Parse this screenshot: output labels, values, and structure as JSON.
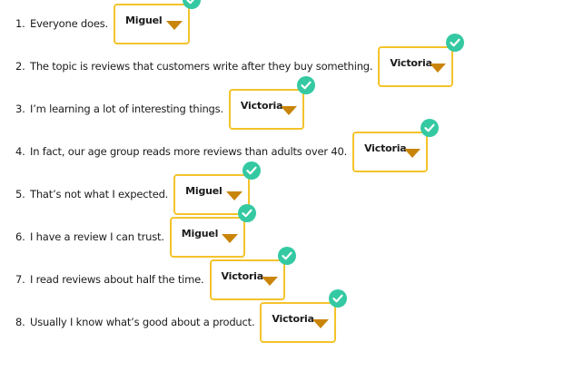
{
  "items": [
    {
      "number": "1.",
      "sentence": "Everyone does.",
      "selected": "Miguel"
    },
    {
      "number": "2.",
      "sentence": "The topic is reviews that customers write after they buy something.",
      "selected": "Victoria"
    },
    {
      "number": "3.",
      "sentence": "I’m learning a lot of interesting things.",
      "selected": "Victoria"
    },
    {
      "number": "4.",
      "sentence": "In fact, our age group reads more reviews than adults over 40.",
      "selected": "Victoria"
    },
    {
      "number": "5.",
      "sentence": "That’s not what I expected.",
      "selected": "Miguel"
    },
    {
      "number": "6.",
      "sentence": "I have a review I can trust.",
      "selected": "Miguel"
    },
    {
      "number": "7.",
      "sentence": "I read reviews about half the time.",
      "selected": "Victoria"
    },
    {
      "number": "8.",
      "sentence": "Usually I know what’s good about a product.",
      "selected": "Victoria"
    }
  ],
  "icons": {
    "correct": "checkmark-icon",
    "dropdown": "caret-down-icon"
  },
  "colors": {
    "dropdown_border": "#f4c32b",
    "caret": "#c9850a",
    "check_badge": "#34c9a2",
    "text": "#1b1b1b"
  }
}
